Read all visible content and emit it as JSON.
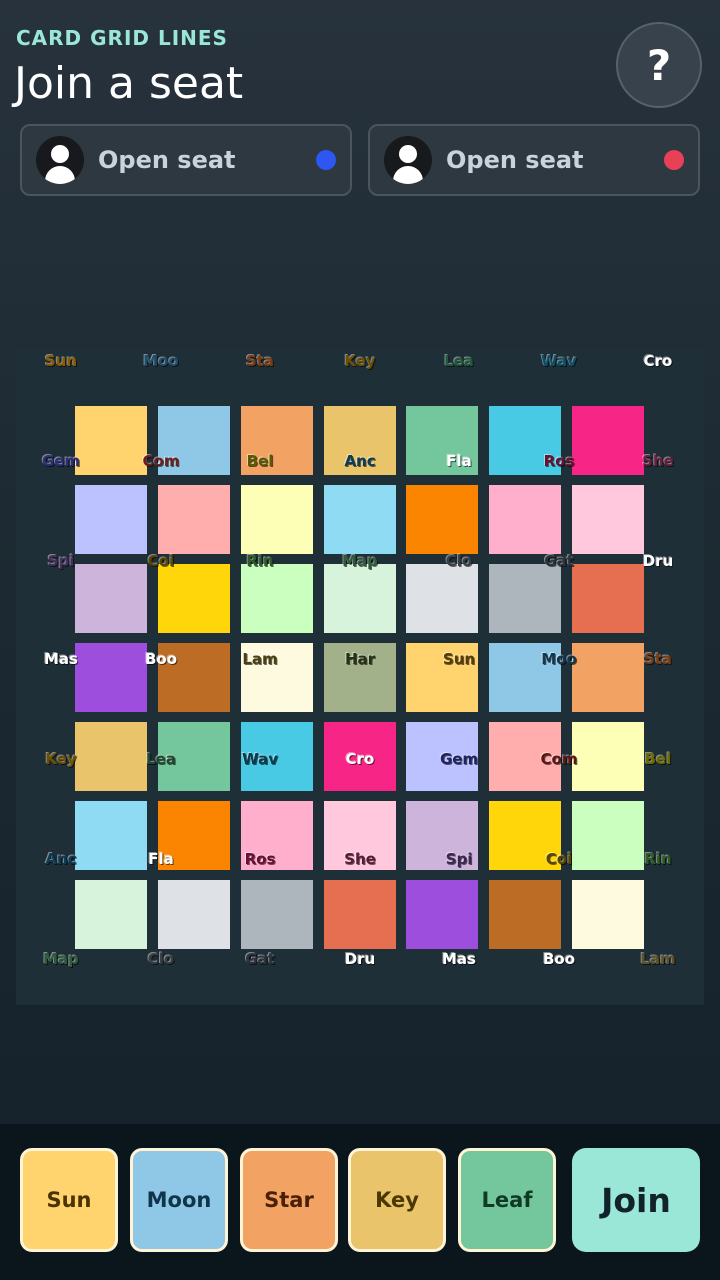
{
  "header": {
    "kicker": "CARD GRID LINES",
    "title": "Join a seat",
    "help_label": "?"
  },
  "seats": [
    {
      "label": "Open seat",
      "color": "#2f56f0"
    },
    {
      "label": "Open seat",
      "color": "#e84057"
    }
  ],
  "board": {
    "rows": [
      [
        "#ffd36e",
        "#8ec8e6",
        "#f2a263",
        "#e9c46a",
        "#74c69d",
        "#48cae4",
        "#f72585"
      ],
      [
        "#bbc2ff",
        "#ffadad",
        "#fdffb6",
        "#90dbf4",
        "#fb8500",
        "#ffafcc",
        "#ffc8dd"
      ],
      [
        "#cdb4db",
        "#ffd60a",
        "#caffbf",
        "#d8f3dc",
        "#dee2e6",
        "#adb5bd",
        "#e76f51"
      ],
      [
        "#9d4edd",
        "#bc6c25",
        "#fefae0",
        "#a3b18a",
        "#ffd36e",
        "#8ec8e6",
        "#f2a263"
      ],
      [
        "#e9c46a",
        "#74c69d",
        "#48cae4",
        "#f72585",
        "#bbc2ff",
        "#ffadad",
        "#fdffb6"
      ],
      [
        "#90dbf4",
        "#fb8500",
        "#ffafcc",
        "#ffc8dd",
        "#cdb4db",
        "#ffd60a",
        "#caffbf"
      ],
      [
        "#d8f3dc",
        "#dee2e6",
        "#adb5bd",
        "#e76f51",
        "#9d4edd",
        "#bc6c25",
        "#fefae0"
      ]
    ],
    "point_labels": [
      [
        {
          "t": "Sun",
          "c": "#8a5a00"
        },
        {
          "t": "Moo",
          "c": "#1d4e6b"
        },
        {
          "t": "Sta",
          "c": "#7a3b10"
        },
        {
          "t": "Key",
          "c": "#6b5000"
        },
        {
          "t": "Lea",
          "c": "#1e5b3c"
        },
        {
          "t": "Wav",
          "c": "#0b5068"
        },
        {
          "t": "Cro",
          "c": "#ffffff"
        }
      ],
      [
        {
          "t": "Gem",
          "c": "#2c2f7a"
        },
        {
          "t": "Com",
          "c": "#6b1f1f"
        },
        {
          "t": "Bel",
          "c": "#5a5a00"
        },
        {
          "t": "Anc",
          "c": "#0d3c55"
        },
        {
          "t": "Fla",
          "c": "#ffffff"
        },
        {
          "t": "Ros",
          "c": "#6b1033"
        },
        {
          "t": "She",
          "c": "#6b2040"
        }
      ],
      [
        {
          "t": "Spi",
          "c": "#4a2d5e"
        },
        {
          "t": "Coi",
          "c": "#5a4500"
        },
        {
          "t": "Rin",
          "c": "#2d5a25"
        },
        {
          "t": "Map",
          "c": "#2d5a3c"
        },
        {
          "t": "Clo",
          "c": "#3a3f45"
        },
        {
          "t": "Gat",
          "c": "#2d333a"
        },
        {
          "t": "Dru",
          "c": "#ffffff"
        }
      ],
      [
        {
          "t": "Mas",
          "c": "#ffffff"
        },
        {
          "t": "Boo",
          "c": "#ffffff"
        },
        {
          "t": "Lam",
          "c": "#4a3f10"
        },
        {
          "t": "Har",
          "c": "#263016"
        },
        {
          "t": "Sun",
          "c": "#5a3c00"
        },
        {
          "t": "Moo",
          "c": "#12384f"
        },
        {
          "t": "Sta",
          "c": "#7a3b10"
        }
      ],
      [
        {
          "t": "Key",
          "c": "#6b5000"
        },
        {
          "t": "Lea",
          "c": "#1e4a30"
        },
        {
          "t": "Wav",
          "c": "#073c4f"
        },
        {
          "t": "Cro",
          "c": "#ffffff"
        },
        {
          "t": "Gem",
          "c": "#1f2366"
        },
        {
          "t": "Com",
          "c": "#5c1515"
        },
        {
          "t": "Bel",
          "c": "#6b6b00"
        }
      ],
      [
        {
          "t": "Anc",
          "c": "#0d3c55"
        },
        {
          "t": "Fla",
          "c": "#ffffff"
        },
        {
          "t": "Ros",
          "c": "#6b1033"
        },
        {
          "t": "She",
          "c": "#5c1a36"
        },
        {
          "t": "Spi",
          "c": "#3d2552"
        },
        {
          "t": "Coi",
          "c": "#5a4500"
        },
        {
          "t": "Rin",
          "c": "#2d5a25"
        }
      ],
      [
        {
          "t": "Map",
          "c": "#2d5a3c"
        },
        {
          "t": "Clo",
          "c": "#3a3f45"
        },
        {
          "t": "Gat",
          "c": "#2d333a"
        },
        {
          "t": "Dru",
          "c": "#ffffff"
        },
        {
          "t": "Mas",
          "c": "#ffffff"
        },
        {
          "t": "Boo",
          "c": "#ffffff"
        },
        {
          "t": "Lam",
          "c": "#5c5228"
        }
      ]
    ]
  },
  "hand": [
    {
      "label": "Sun",
      "color": "#ffd36e",
      "text": "#4a3300"
    },
    {
      "label": "Moon",
      "color": "#8ec8e6",
      "text": "#10344a"
    },
    {
      "label": "Star",
      "color": "#f2a263",
      "text": "#4a2006"
    },
    {
      "label": "Key",
      "color": "#e9c46a",
      "text": "#4a3800"
    },
    {
      "label": "Leaf",
      "color": "#74c69d",
      "text": "#0f3a24"
    }
  ],
  "join_label": "Join"
}
